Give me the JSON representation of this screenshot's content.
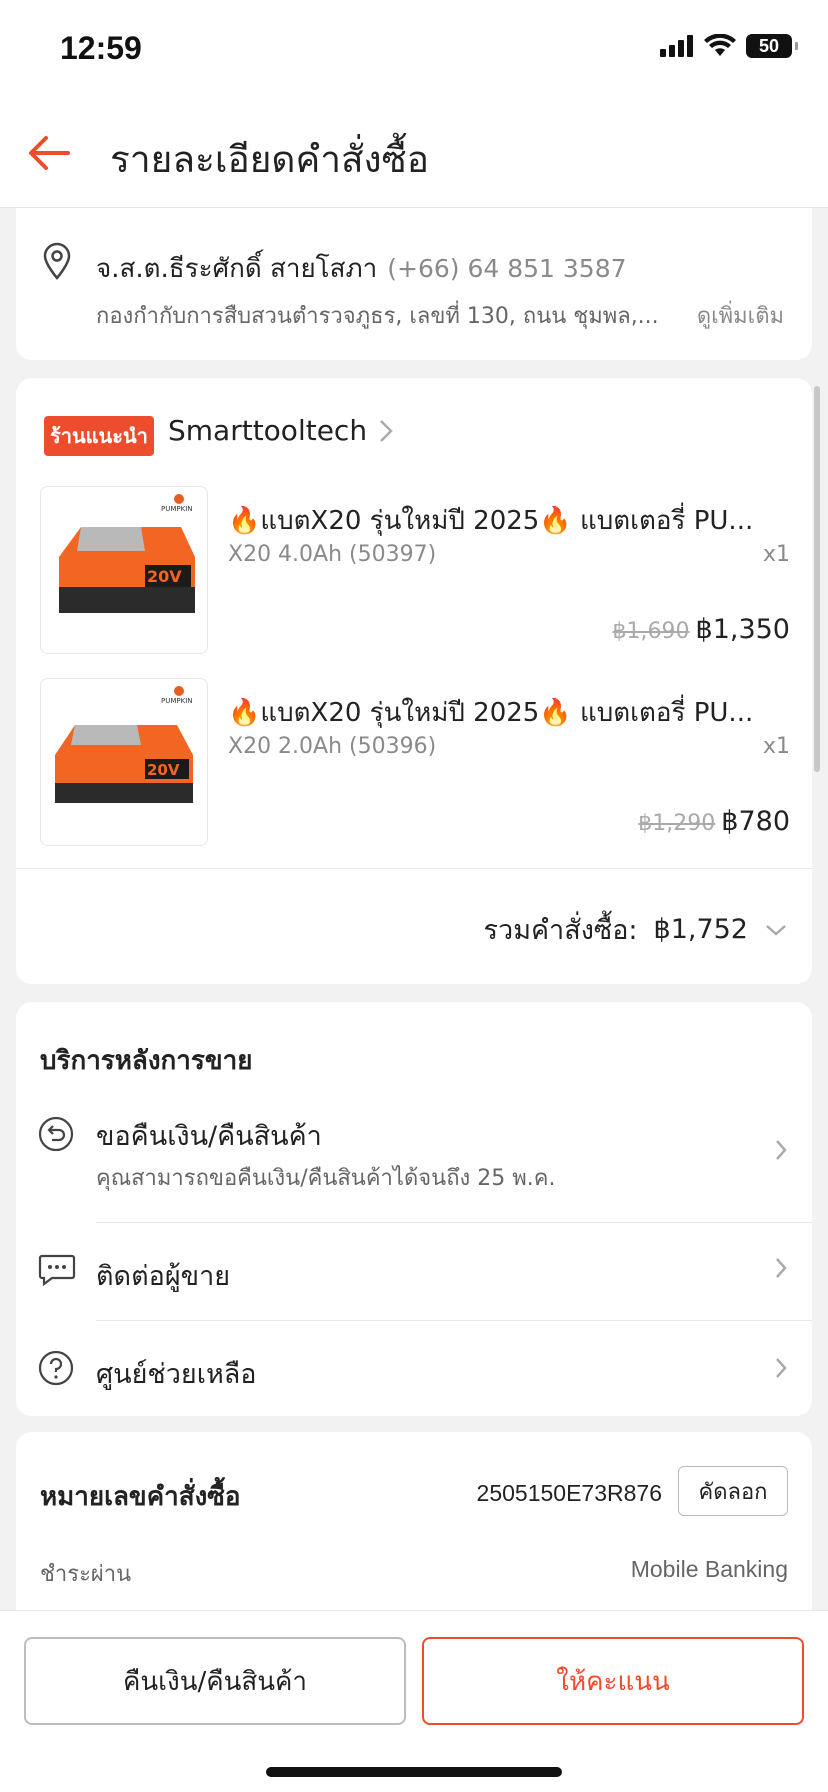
{
  "status": {
    "time": "12:59",
    "battery": "50"
  },
  "header": {
    "title": "รายละเอียดคำสั่งซื้อ"
  },
  "address": {
    "name": "จ.ส.ต.ธีระศักดิ์ สายโสภา",
    "phone": "(+66) 64 851 3587",
    "line": "กองกำกับการสืบสวนตำรวจภูธร, เลขที่ 130, ถนน ชุมพล,...",
    "more": "ดูเพิ่มเติม"
  },
  "shop": {
    "badge": "ร้านแนะนำ",
    "name": "Smarttooltech",
    "items": [
      {
        "title": "🔥แบตX20 รุ่นใหม่ปี 2025🔥 แบตเตอรี่ PU...",
        "variant": "X20 4.0Ah (50397)",
        "qty": "x1",
        "old_price": "฿1,690",
        "price": "฿1,350",
        "brand": "PUMPKIN",
        "label": "20V"
      },
      {
        "title": "🔥แบตX20 รุ่นใหม่ปี 2025🔥 แบตเตอรี่ PU...",
        "variant": "X20 2.0Ah (50396)",
        "qty": "x1",
        "old_price": "฿1,290",
        "price": "฿780",
        "brand": "PUMPKIN",
        "label": "20V"
      }
    ],
    "total_label": "รวมคำสั่งซื้อ:",
    "total_value": "฿1,752"
  },
  "after_sales": {
    "heading": "บริการหลังการขาย",
    "return_title": "ขอคืนเงิน/คืนสินค้า",
    "return_sub": "คุณสามารถขอคืนเงิน/คืนสินค้าได้จนถึง 25 พ.ค.",
    "contact": "ติดต่อผู้ขาย",
    "help": "ศูนย์ช่วยเหลือ"
  },
  "order_info": {
    "number_label": "หมายเลขคำสั่งซื้อ",
    "number": "2505150E73R876",
    "copy": "คัดลอก",
    "pay_label": "ชำระผ่าน",
    "pay_value": "Mobile Banking"
  },
  "actions": {
    "refund": "คืนเงิน/คืนสินค้า",
    "rate": "ให้คะแนน"
  },
  "colors": {
    "accent": "#ee4d2d"
  }
}
